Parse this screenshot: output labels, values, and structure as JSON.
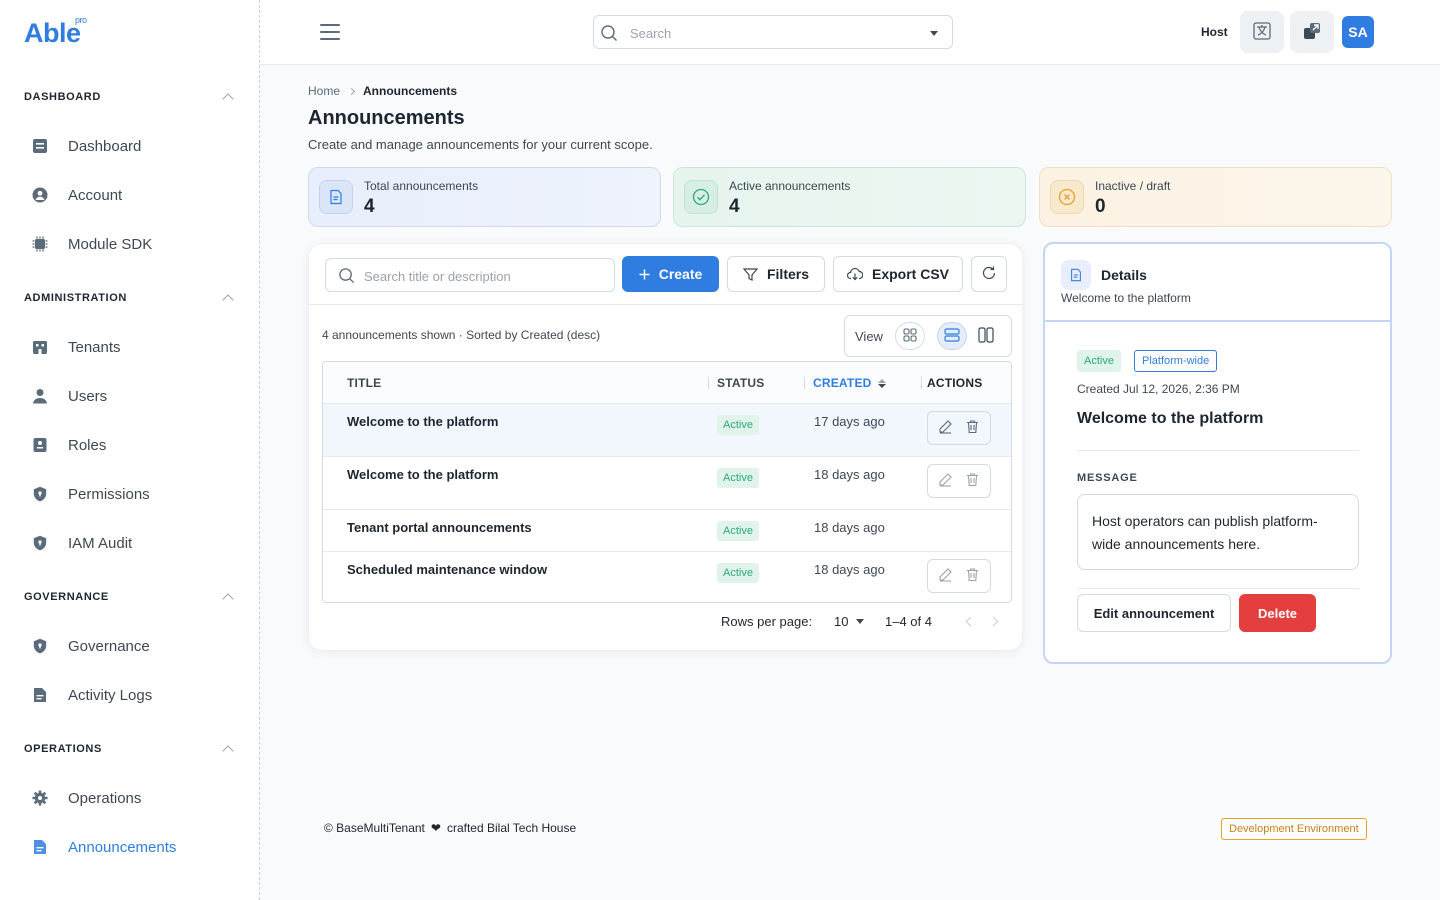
{
  "brand": {
    "name": "Able",
    "tag": "pro",
    "color": "#2f7de1"
  },
  "sidebar": {
    "sections": [
      {
        "title": "DASHBOARD",
        "items": [
          {
            "label": "Dashboard",
            "icon": "dashboard-icon"
          },
          {
            "label": "Account",
            "icon": "account-icon"
          },
          {
            "label": "Module SDK",
            "icon": "chip-icon"
          }
        ]
      },
      {
        "title": "ADMINISTRATION",
        "items": [
          {
            "label": "Tenants",
            "icon": "building-icon"
          },
          {
            "label": "Users",
            "icon": "user-icon"
          },
          {
            "label": "Roles",
            "icon": "badge-icon"
          },
          {
            "label": "Permissions",
            "icon": "shield-icon"
          },
          {
            "label": "IAM Audit",
            "icon": "shield-icon"
          }
        ]
      },
      {
        "title": "GOVERNANCE",
        "items": [
          {
            "label": "Governance",
            "icon": "shield-icon"
          },
          {
            "label": "Activity Logs",
            "icon": "document-icon"
          }
        ]
      },
      {
        "title": "OPERATIONS",
        "items": [
          {
            "label": "Operations",
            "icon": "gear-icon"
          },
          {
            "label": "Announcements",
            "icon": "document-icon",
            "active": true
          }
        ]
      }
    ]
  },
  "header": {
    "search_placeholder": "Search",
    "host_label": "Host",
    "avatar_initials": "SA"
  },
  "page": {
    "breadcrumb": [
      "Home",
      "Announcements"
    ],
    "title": "Announcements",
    "subtitle": "Create and manage announcements for your current scope."
  },
  "stats": [
    {
      "label": "Total announcements",
      "value": "4",
      "tone": "blue"
    },
    {
      "label": "Active announcements",
      "value": "4",
      "tone": "green"
    },
    {
      "label": "Inactive / draft",
      "value": "0",
      "tone": "amber"
    }
  ],
  "toolbar": {
    "search_placeholder": "Search title or description",
    "create_label": "Create",
    "filters_label": "Filters",
    "export_label": "Export CSV"
  },
  "list": {
    "meta": "4 announcements shown · Sorted by Created (desc)",
    "view_label": "View",
    "columns": {
      "title": "TITLE",
      "status": "STATUS",
      "created": "CREATED",
      "actions": "ACTIONS"
    },
    "rows": [
      {
        "title": "Welcome to the platform",
        "status": "Active",
        "created": "17 days ago",
        "has_actions": true,
        "selected": true
      },
      {
        "title": "Welcome to the platform",
        "status": "Active",
        "created": "18 days ago",
        "has_actions": true,
        "selected": false
      },
      {
        "title": "Tenant portal announcements",
        "status": "Active",
        "created": "18 days ago",
        "has_actions": false,
        "selected": false
      },
      {
        "title": "Scheduled maintenance window",
        "status": "Active",
        "created": "18 days ago",
        "has_actions": true,
        "selected": false
      }
    ],
    "rows_per_page_label": "Rows per page:",
    "rows_per_page": "10",
    "range": "1–4 of 4"
  },
  "details": {
    "title": "Details",
    "subtitle": "Welcome to the platform",
    "status_chip": "Active",
    "scope_chip": "Platform-wide",
    "created": "Created Jul 12, 2026, 2:36 PM",
    "heading": "Welcome to the platform",
    "message_label": "MESSAGE",
    "message": "Host operators can publish platform-wide announcements here.",
    "edit_label": "Edit announcement",
    "delete_label": "Delete"
  },
  "footer": {
    "copyright": "© BaseMultiTenant",
    "crafted": "crafted Bilal Tech House",
    "environment": "Development Environment"
  }
}
